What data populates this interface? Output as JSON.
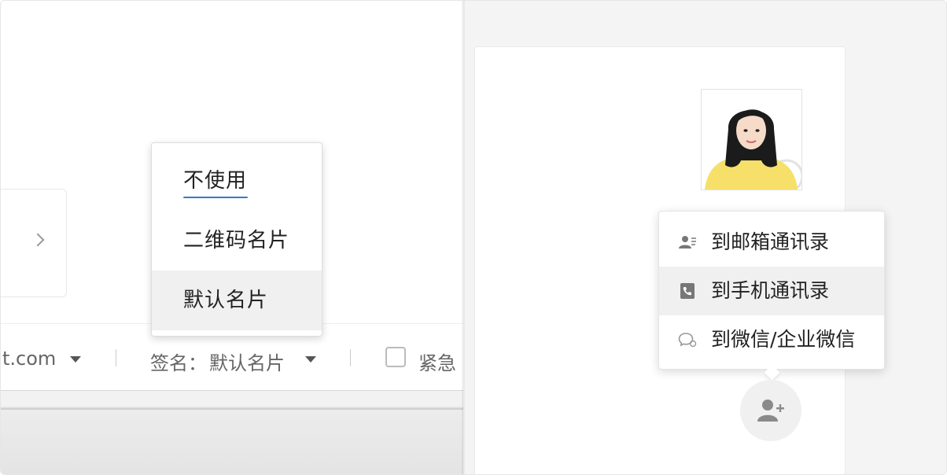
{
  "toolbar": {
    "sender_partial": "t.com",
    "signature_label": "签名：",
    "signature_value": "默认名片",
    "urgent_label": "紧急"
  },
  "signature_menu": {
    "items": [
      {
        "label": "不使用"
      },
      {
        "label": "二维码名片"
      },
      {
        "label": "默认名片"
      }
    ],
    "highlighted_index": 2
  },
  "contact_menu": {
    "items": [
      {
        "label": "到邮箱通讯录",
        "icon": "contact-card-icon"
      },
      {
        "label": "到手机通讯录",
        "icon": "phone-icon"
      },
      {
        "label": "到微信/企业微信",
        "icon": "wechat-icon"
      }
    ],
    "highlighted_index": 1
  },
  "colors": {
    "menu_highlight": "#f0f0f0",
    "underline_accent": "#3a78c9",
    "right_bg": "#f4f4f4"
  }
}
